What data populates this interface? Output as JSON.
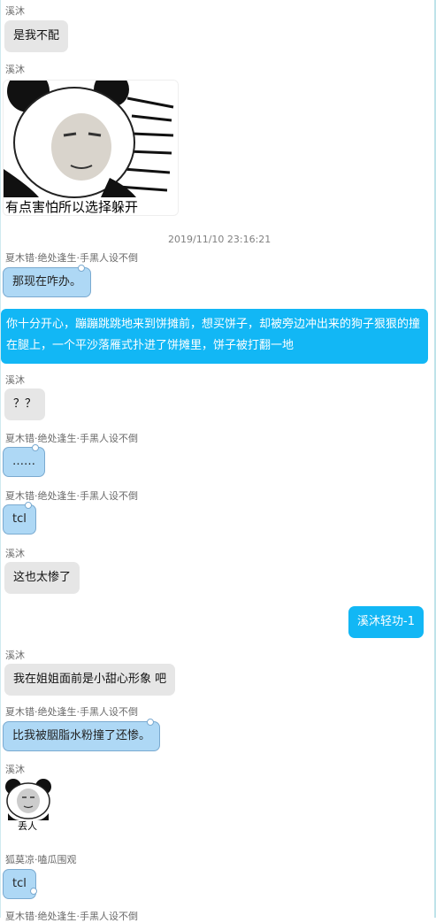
{
  "messages": {
    "m1_name": "溪沐",
    "m1_text": "是我不配",
    "m2_name": "溪沐",
    "m2_sticker_caption": "有点害怕所以选择躲开",
    "timestamp": "2019/11/10 23:16:21",
    "m3_name": "夏木错·绝处逢生·手黑人设不倒",
    "m3_text": "那现在咋办。",
    "m4_line1": "你十分开心，蹦蹦跳跳地来到饼摊前，想买饼子，却被旁边冲出来的狗子狠狠的撞",
    "m4_line2": "在腿上，一个平沙落雁式扑进了饼摊里，饼子被打翻一地",
    "m5_name": "溪沐",
    "m5_text": "？？",
    "m6_name": "夏木错·绝处逢生·手黑人设不倒",
    "m6_text": "……",
    "m7_name": "夏木错·绝处逢生·手黑人设不倒",
    "m7_text": "tcl",
    "m8_name": "溪沐",
    "m8_text": "这也太惨了",
    "m9_text": "溪沐轻功-1",
    "m10_name": "溪沐",
    "m10_text": "我在姐姐面前是小甜心形象 吧",
    "m11_name": "夏木错·绝处逢生·手黑人设不倒",
    "m11_text": "比我被胭脂水粉撞了还惨。",
    "m12_name": "溪沐",
    "m12_sticker_caption": "丢人",
    "m13_name": "狐莫凉·嗑瓜围观",
    "m13_text": "tcl",
    "m14_name": "夏木错·绝处逢生·手黑人设不倒"
  },
  "colors": {
    "self_bubble": "#12b7f5",
    "other_gray_bubble": "#e6e6e6",
    "other_blue_bubble": "#aed8f5"
  }
}
